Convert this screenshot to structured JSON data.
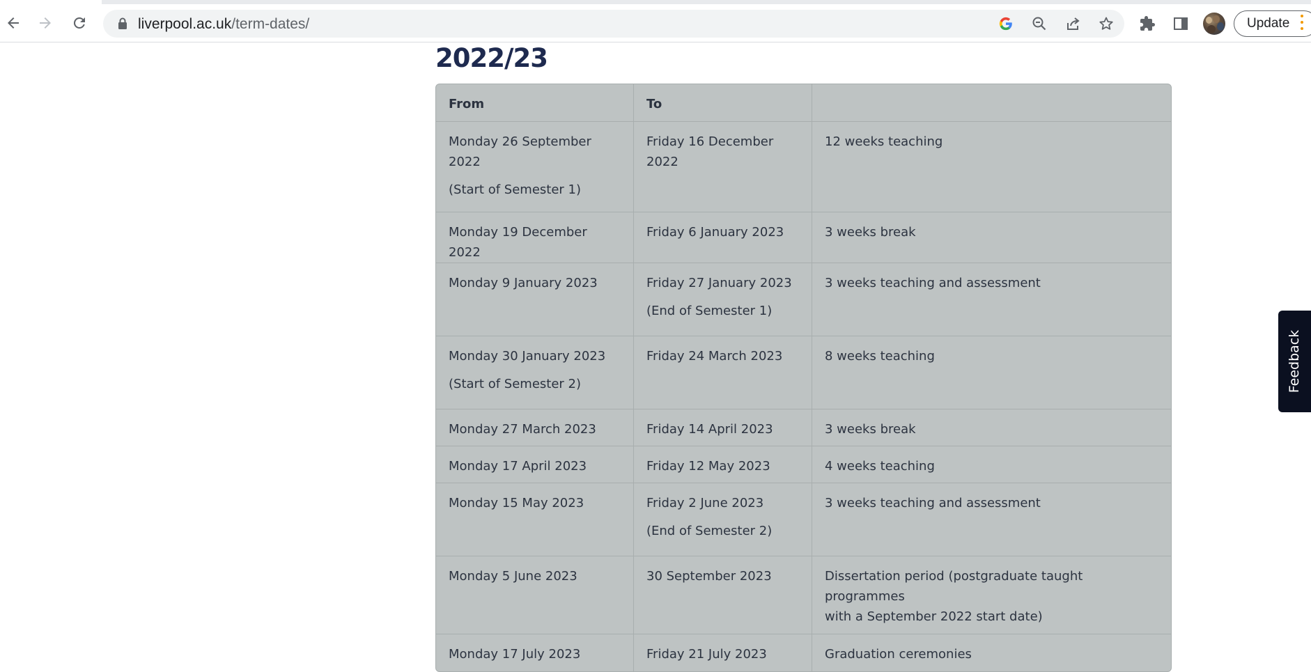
{
  "browser": {
    "url_domain": "liverpool.ac.uk",
    "url_path": "/term-dates/",
    "update_label": "Update",
    "icons": {
      "back": "back-arrow-icon",
      "forward": "forward-arrow-icon",
      "reload": "reload-icon",
      "lock": "lock-icon",
      "google": "google-icon",
      "zoom": "zoom-out-icon",
      "share": "share-icon",
      "bookmark": "star-icon",
      "extensions": "puzzle-icon",
      "side_panel": "side-panel-icon",
      "profile": "avatar"
    }
  },
  "page": {
    "year_heading": "2022/23",
    "table": {
      "headers": [
        "From",
        "To",
        ""
      ],
      "rows": [
        {
          "from": "Monday 26 September 2022",
          "from_note": "(Start of Semester 1)",
          "to": "Friday 16 December 2022",
          "to_note": "",
          "desc": "12 weeks teaching",
          "desc_extra": ""
        },
        {
          "from": "Monday 19 December 2022",
          "from_note": "",
          "to": "Friday 6 January 2023",
          "to_note": "",
          "desc": "3 weeks break",
          "desc_extra": ""
        },
        {
          "from": "Monday 9 January 2023",
          "from_note": "",
          "to": "Friday 27 January 2023",
          "to_note": "(End of Semester 1)",
          "desc": "3 weeks teaching and assessment",
          "desc_extra": ""
        },
        {
          "from": "Monday 30 January 2023",
          "from_note": "(Start of Semester 2)",
          "to": "Friday 24 March 2023",
          "to_note": "",
          "desc": "8 weeks teaching",
          "desc_extra": ""
        },
        {
          "from": "Monday 27 March 2023",
          "from_note": "",
          "to": "Friday 14 April 2023",
          "to_note": "",
          "desc": "3 weeks break",
          "desc_extra": ""
        },
        {
          "from": "Monday 17 April 2023",
          "from_note": "",
          "to": "Friday 12 May 2023",
          "to_note": "",
          "desc": "4 weeks teaching",
          "desc_extra": ""
        },
        {
          "from": "Monday 15 May 2023",
          "from_note": "",
          "to": "Friday 2 June 2023",
          "to_note": "(End of Semester 2)",
          "desc": "3 weeks teaching and assessment",
          "desc_extra": ""
        },
        {
          "from": "Monday 5 June 2023",
          "from_note": "",
          "to": "30 September 2023",
          "to_note": "",
          "desc": "Dissertation period (postgraduate taught programmes",
          "desc_extra": "with a September 2022 start date)"
        },
        {
          "from": "Monday 17 July 2023",
          "from_note": "",
          "to": "Friday 21 July 2023",
          "to_note": "",
          "desc": "Graduation ceremonies",
          "desc_extra": ""
        }
      ]
    },
    "feedback_label": "Feedback"
  }
}
